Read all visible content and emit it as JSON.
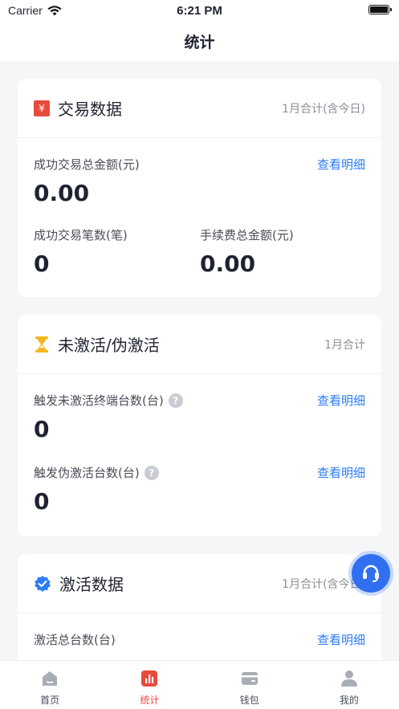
{
  "status_bar": {
    "carrier": "Carrier",
    "time": "6:21 PM"
  },
  "header": {
    "title": "统计"
  },
  "colors": {
    "accent": "#e84a3c",
    "link": "#2b7cf6",
    "fab": "#2f6ff0"
  },
  "cards": {
    "transaction": {
      "icon": "yen-icon",
      "title": "交易数据",
      "period": "1月合计(含今日)",
      "amount_label": "成功交易总金额(元)",
      "amount_value": "0.00",
      "detail_link": "查看明细",
      "count_label": "成功交易笔数(笔)",
      "count_value": "0",
      "fee_label": "手续费总金额(元)",
      "fee_value": "0.00"
    },
    "inactive": {
      "icon": "hourglass-icon",
      "title": "未激活/伪激活",
      "period": "1月合计",
      "unactivated_label": "触发未激活终端台数(台)",
      "unactivated_value": "0",
      "unactivated_link": "查看明细",
      "fake_label": "触发伪激活台数(台)",
      "fake_value": "0",
      "fake_link": "查看明细",
      "help_glyph": "?"
    },
    "activation": {
      "icon": "verify-icon",
      "title": "激活数据",
      "period": "1月合计(含今日)",
      "total_label": "激活总台数(台)",
      "detail_link": "查看明细"
    }
  },
  "yen_glyph": "¥",
  "tabs": [
    {
      "label": "首页",
      "icon": "home-icon",
      "active": false
    },
    {
      "label": "统计",
      "icon": "stats-icon",
      "active": true
    },
    {
      "label": "钱包",
      "icon": "wallet-icon",
      "active": false
    },
    {
      "label": "我的",
      "icon": "profile-icon",
      "active": false
    }
  ]
}
